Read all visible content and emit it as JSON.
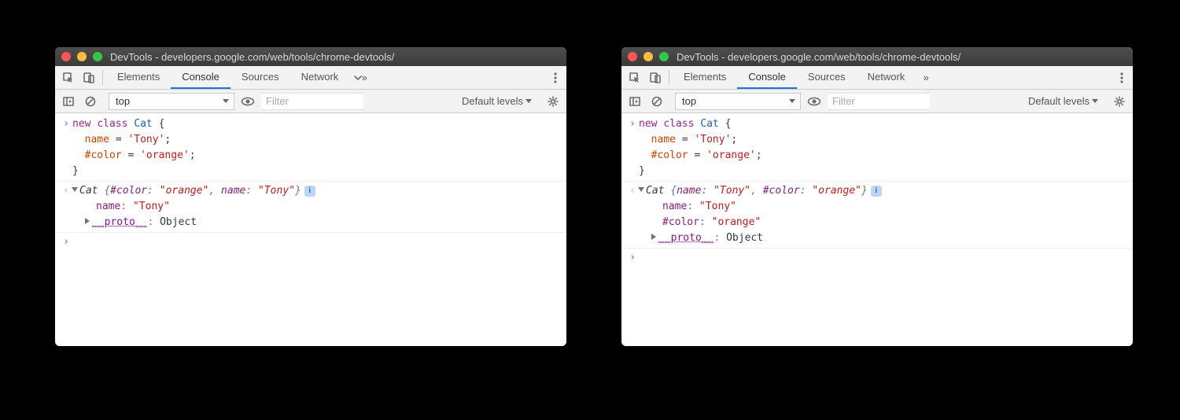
{
  "windows": [
    {
      "title": "DevTools - developers.google.com/web/tools/chrome-devtools/",
      "tabs": [
        "Elements",
        "Console",
        "Sources",
        "Network"
      ],
      "active_tab": "Console",
      "toolbar": {
        "context": "top",
        "filter_placeholder": "Filter",
        "levels": "Default levels"
      },
      "input_code": {
        "l1": "new class Cat {",
        "l2": "  name = 'Tony';",
        "l3": "  #color = 'orange';",
        "l4": "}",
        "tokens": {
          "kw_new": "new",
          "kw_class": "class",
          "typename": "Cat",
          "name_field": "name",
          "color_field": "#color",
          "str_tony_sq": "'Tony'",
          "str_orange_sq": "'orange'"
        }
      },
      "output": {
        "summary": {
          "classname": "Cat",
          "prop_color": "#color",
          "val_color": "\"orange\"",
          "sep": ", ",
          "prop_name": "name",
          "val_name": "\"Tony\""
        },
        "lines": [
          {
            "prop": "name",
            "val": "\"Tony\""
          }
        ],
        "proto": {
          "label": "__proto__",
          "val": "Object"
        }
      }
    },
    {
      "title": "DevTools - developers.google.com/web/tools/chrome-devtools/",
      "tabs": [
        "Elements",
        "Console",
        "Sources",
        "Network"
      ],
      "active_tab": "Console",
      "toolbar": {
        "context": "top",
        "filter_placeholder": "Filter",
        "levels": "Default levels"
      },
      "input_code": {
        "l1": "new class Cat {",
        "l2": "  name = 'Tony';",
        "l3": "  #color = 'orange';",
        "l4": "}",
        "tokens": {
          "kw_new": "new",
          "kw_class": "class",
          "typename": "Cat",
          "name_field": "name",
          "color_field": "#color",
          "str_tony_sq": "'Tony'",
          "str_orange_sq": "'orange'"
        }
      },
      "output": {
        "summary": {
          "classname": "Cat",
          "prop_name": "name",
          "val_name": "\"Tony\"",
          "sep": ", ",
          "prop_color": "#color",
          "val_color": "\"orange\""
        },
        "lines": [
          {
            "prop": "name",
            "val": "\"Tony\""
          },
          {
            "prop": "#color",
            "val": "\"orange\""
          }
        ],
        "proto": {
          "label": "__proto__",
          "val": "Object"
        }
      }
    }
  ]
}
